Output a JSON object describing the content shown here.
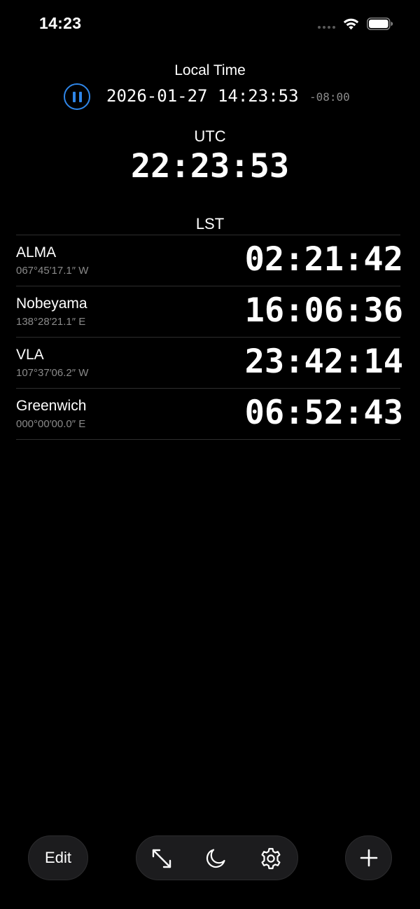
{
  "status_bar": {
    "time": "14:23",
    "icons": [
      "signal-dots-icon",
      "wifi-icon",
      "battery-icon"
    ]
  },
  "local": {
    "label": "Local Time",
    "datetime": "2026-01-27 14:23:53",
    "offset": "-08:00",
    "pause_icon": "pause-icon"
  },
  "utc": {
    "label": "UTC",
    "time": "22:23:53"
  },
  "lst": {
    "label": "LST",
    "sites": [
      {
        "name": "ALMA",
        "longitude": "067°45′17.1″ W",
        "lst": "02:21:42"
      },
      {
        "name": "Nobeyama",
        "longitude": "138°28′21.1″ E",
        "lst": "16:06:36"
      },
      {
        "name": "VLA",
        "longitude": "107°37′06.2″ W",
        "lst": "23:42:14"
      },
      {
        "name": "Greenwich",
        "longitude": "000°00′00.0″ E",
        "lst": "06:52:43"
      }
    ]
  },
  "toolbar": {
    "edit_label": "Edit",
    "tools": [
      "expand-icon",
      "moon-icon",
      "gear-icon"
    ],
    "add_icon": "plus-icon"
  },
  "colors": {
    "background": "#000000",
    "accent": "#2f86e8",
    "secondary_text": "#8a8a8a",
    "button_bg": "#1c1c1e",
    "separator": "#2e2e2e"
  }
}
